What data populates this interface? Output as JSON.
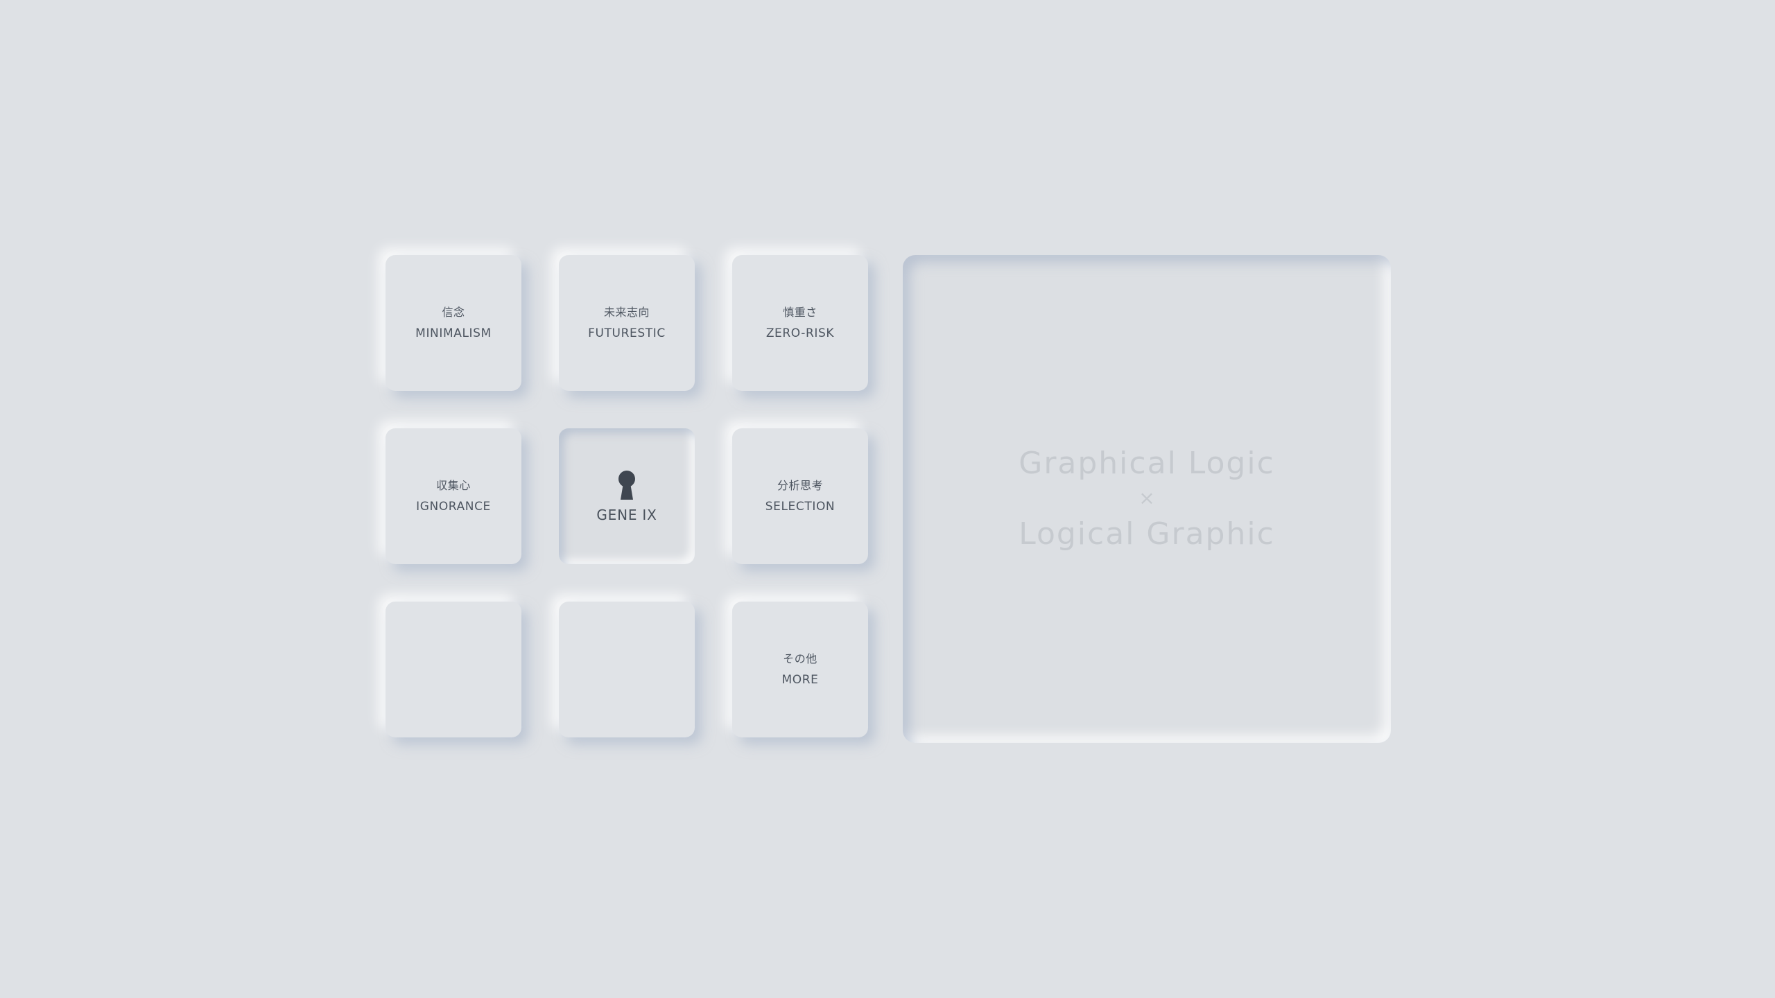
{
  "grid": {
    "tiles": [
      {
        "jp": "信念",
        "en": "MINIMALISM"
      },
      {
        "jp": "未来志向",
        "en": "FUTURESTIC"
      },
      {
        "jp": "慎重さ",
        "en": "ZERO-RISK"
      },
      {
        "jp": "収集心",
        "en": "IGNORANCE"
      },
      {
        "jp": "",
        "en": "GENE IX",
        "icon": "keyhole-icon",
        "state": "pressed"
      },
      {
        "jp": "分析思考",
        "en": "SELECTION"
      },
      {
        "jp": "",
        "en": ""
      },
      {
        "jp": "",
        "en": ""
      },
      {
        "jp": "その他",
        "en": "MORE"
      }
    ]
  },
  "panel": {
    "line1": "Graphical Logic",
    "separator": "×",
    "line2": "Logical Graphic"
  },
  "colors": {
    "background": "#dee1e5",
    "text": "#4d5560",
    "panel_text": "#c6cacf",
    "icon": "#3f4650"
  }
}
